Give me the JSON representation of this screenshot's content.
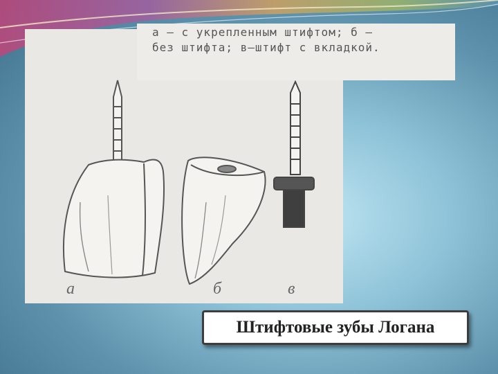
{
  "figure": {
    "caption_line1": "а — с укрепленным штифтом; б —",
    "caption_line2": "без штифта; в—штифт с вкладкой.",
    "labels": {
      "a": "а",
      "b": "б",
      "v": "в"
    }
  },
  "slide": {
    "title": "Штифтовые зубы Логана"
  }
}
